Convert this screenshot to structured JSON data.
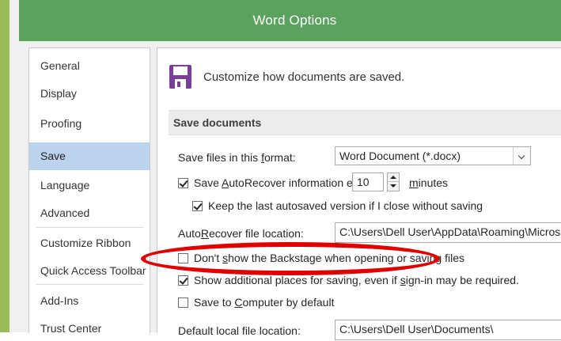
{
  "window": {
    "title": "Word Options"
  },
  "nav": {
    "items": [
      {
        "label": "General"
      },
      {
        "label": "Display"
      },
      {
        "label": "Proofing"
      },
      {
        "label": "Save"
      },
      {
        "label": "Language"
      },
      {
        "label": "Advanced"
      },
      {
        "label": "Customize Ribbon"
      },
      {
        "label": "Quick Access Toolbar"
      },
      {
        "label": "Add-Ins"
      },
      {
        "label": "Trust Center"
      }
    ],
    "selected": "Save"
  },
  "header": {
    "text": "Customize how documents are saved.",
    "icon": "save-disk-icon"
  },
  "section": {
    "title": "Save documents"
  },
  "save_format": {
    "label_pre": "Save files in this ",
    "label_u": "f",
    "label_post": "ormat:",
    "value": "Word Document (*.docx)"
  },
  "autorecover": {
    "label_pre": "Save ",
    "label_u": "A",
    "label_post": "utoRecover information every",
    "minutes_value": "10",
    "minutes_pre": "",
    "minutes_u": "m",
    "minutes_post": "inutes",
    "checked": true
  },
  "keep_last": {
    "label": "Keep the last autosaved version if I close without saving",
    "checked": true
  },
  "autorecover_location": {
    "label_pre": "Auto",
    "label_u": "R",
    "label_post": "ecover file location:",
    "value": "C:\\Users\\Dell User\\AppData\\Roaming\\Microsoft\\Word\\"
  },
  "backstage": {
    "label_pre": "Don't ",
    "label_u": "s",
    "label_post": "how the Backstage when opening or saving files",
    "checked": false
  },
  "additional_places": {
    "label_pre": "Show additional places for saving, even if ",
    "label_u": "s",
    "label_post": "ign-in may be required.",
    "checked": true
  },
  "save_to_computer": {
    "label_pre": "Save to ",
    "label_u": "C",
    "label_post": "omputer by default",
    "checked": false
  },
  "default_location": {
    "label": "Default local file location:",
    "value": "C:\\Users\\Dell User\\Documents\\"
  },
  "colors": {
    "titlebar": "#5aa25d",
    "accent_border": "#9bbb59",
    "selected_nav": "#bcd3ee",
    "annotation": "#e00000",
    "save_icon": "#7a3f9a"
  }
}
